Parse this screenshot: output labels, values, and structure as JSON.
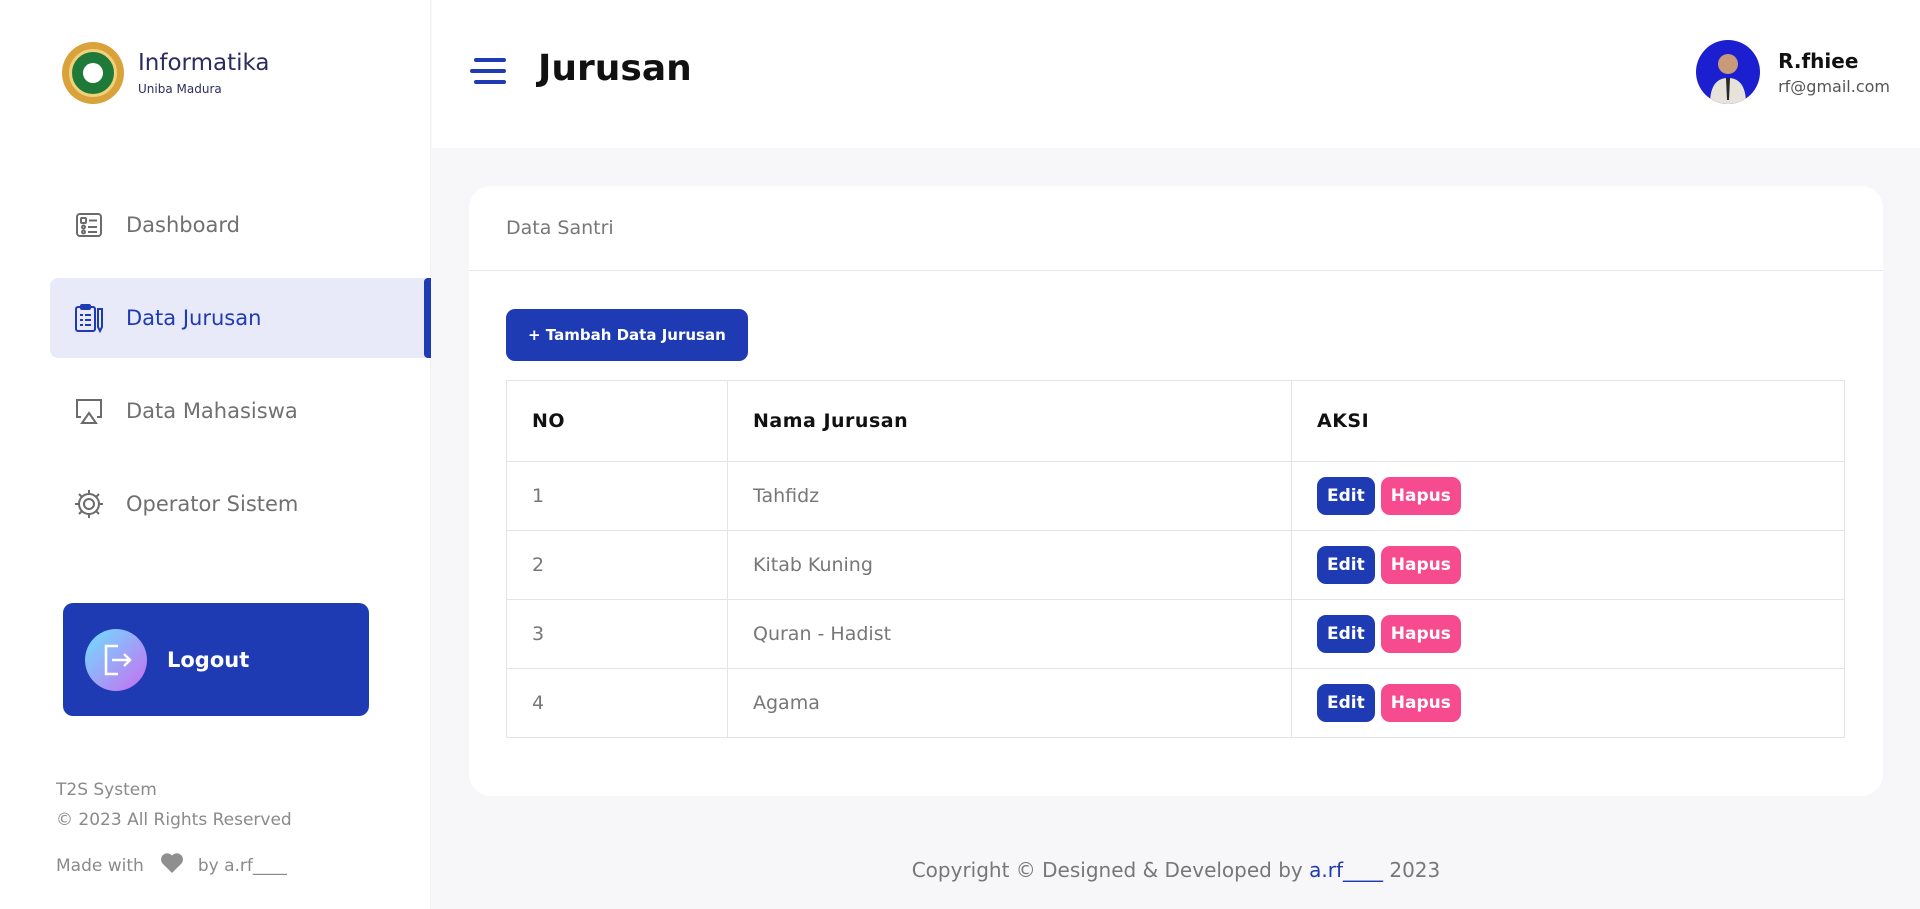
{
  "brand": {
    "title": "Informatika",
    "subtitle": "Uniba Madura"
  },
  "sidebar": {
    "items": [
      {
        "label": "Dashboard",
        "icon": "dashboard-icon",
        "active": false
      },
      {
        "label": "Data Jurusan",
        "icon": "clipboard-icon",
        "active": true
      },
      {
        "label": "Data Mahasiswa",
        "icon": "monitor-icon",
        "active": false
      },
      {
        "label": "Operator Sistem",
        "icon": "gear-icon",
        "active": false
      }
    ],
    "logout_label": "Logout",
    "footer": {
      "system": "T2S System",
      "rights": "© 2023 All Rights Reserved",
      "made_prefix": "Made with",
      "made_suffix": "by a.rf____"
    }
  },
  "header": {
    "title": "Jurusan",
    "user_name": "R.fhiee",
    "user_email": "rf@gmail.com"
  },
  "card": {
    "title": "Data Santri",
    "add_button": "+ Tambah Data Jurusan",
    "columns": [
      "NO",
      "Nama Jurusan",
      "AKSI"
    ],
    "rows": [
      {
        "no": "1",
        "nama": "Tahfidz"
      },
      {
        "no": "2",
        "nama": "Kitab Kuning"
      },
      {
        "no": "3",
        "nama": "Quran - Hadist"
      },
      {
        "no": "4",
        "nama": "Agama"
      }
    ],
    "edit_label": "Edit",
    "delete_label": "Hapus"
  },
  "footer": {
    "prefix": "Copyright © Designed & Developed by",
    "author": "a.rf____",
    "year": "2023"
  },
  "colors": {
    "primary": "#1e3bb3",
    "danger": "#f64b8f",
    "active_bg": "#e8eaf9"
  }
}
